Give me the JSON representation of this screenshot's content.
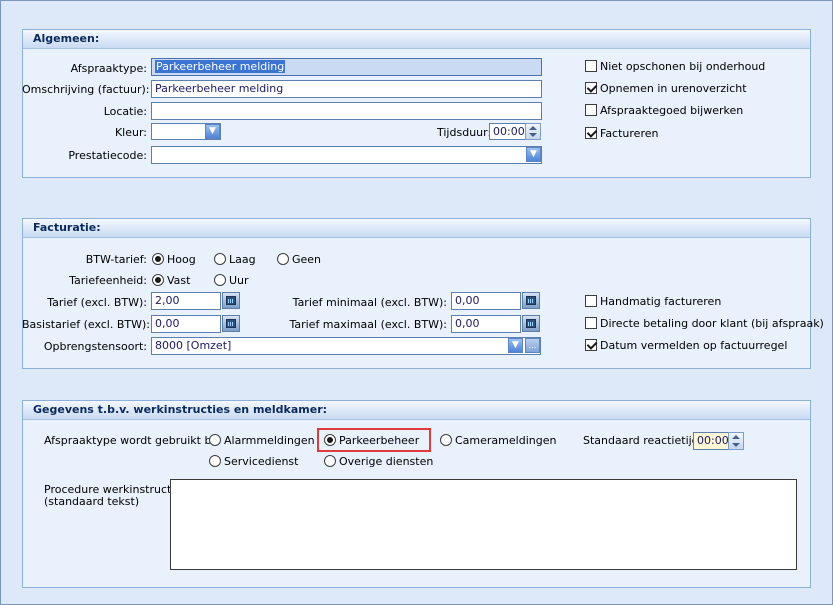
{
  "algemeen": {
    "title": "Algemeen:",
    "afspraaktype_label": "Afspraaktype:",
    "afspraaktype_value": "Parkeerbeheer melding",
    "omschrijving_label": "Omschrijving (factuur):",
    "omschrijving_value": "Parkeerbeheer melding",
    "locatie_label": "Locatie:",
    "locatie_value": "",
    "kleur_label": "Kleur:",
    "tijdsduur_label": "Tijdsduur:",
    "tijdsduur_value": "00:00",
    "prestatiecode_label": "Prestatiecode:",
    "prestatiecode_value": "",
    "checks": [
      {
        "label": "Niet opschonen bij onderhoud",
        "checked": false
      },
      {
        "label": "Opnemen in urenoverzicht",
        "checked": true
      },
      {
        "label": "Afspraaktegoed bijwerken",
        "checked": false
      },
      {
        "label": "Factureren",
        "checked": true
      }
    ]
  },
  "facturatie": {
    "title": "Facturatie:",
    "btw_label": "BTW-tarief:",
    "btw_options": [
      "Hoog",
      "Laag",
      "Geen"
    ],
    "btw_selected": "Hoog",
    "tariefeenheid_label": "Tariefeenheid:",
    "tariefeenheid_options": [
      "Vast",
      "Uur"
    ],
    "tariefeenheid_selected": "Vast",
    "tarief_label": "Tarief (excl. BTW):",
    "tarief_value": "2,00",
    "basistarief_label": "Basistarief (excl. BTW):",
    "basistarief_value": "0,00",
    "tarief_min_label": "Tarief minimaal (excl. BTW):",
    "tarief_min_value": "0,00",
    "tarief_max_label": "Tarief maximaal (excl. BTW):",
    "tarief_max_value": "0,00",
    "opbrengstensoort_label": "Opbrengstensoort:",
    "opbrengstensoort_value": "8000 [Omzet]",
    "checks": [
      {
        "label": "Handmatig factureren",
        "checked": false
      },
      {
        "label": "Directe betaling door klant (bij afspraak)",
        "checked": false
      },
      {
        "label": "Datum vermelden op factuurregel",
        "checked": true
      }
    ]
  },
  "werkinstructies": {
    "title": "Gegevens t.b.v. werkinstructies en meldkamer:",
    "gebruikt_label": "Afspraaktype wordt gebruikt bij:",
    "options": [
      "Alarmmeldingen",
      "Parkeerbeheer",
      "Camerameldingen",
      "Servicedienst",
      "Overige diensten"
    ],
    "selected": "Parkeerbeheer",
    "reactietijd_label": "Standaard reactietijd:",
    "reactietijd_value": "00:00",
    "procedure_label_line1": "Procedure werkinstructie:",
    "procedure_label_line2": "(standaard tekst)",
    "procedure_value": ""
  },
  "colors": {
    "highlight_border": "#e23b3b",
    "panel_header_text": "#0b2a5c",
    "selection": "#3b74d1"
  }
}
